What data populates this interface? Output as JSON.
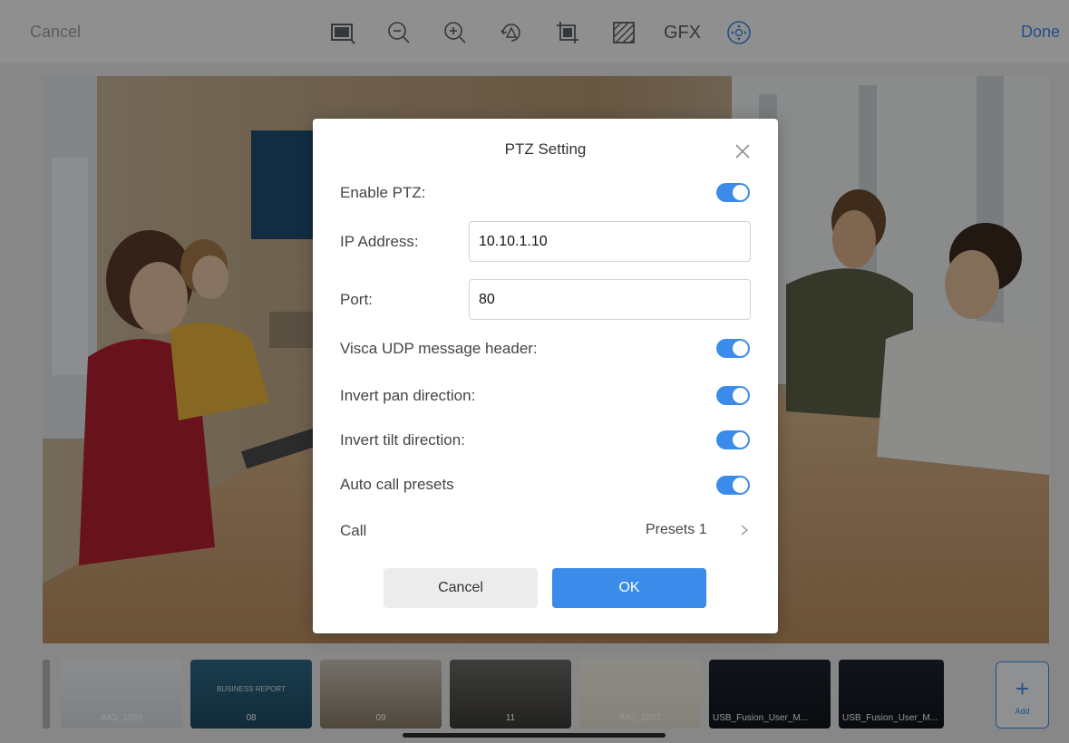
{
  "toolbar": {
    "cancel_label": "Cancel",
    "done_label": "Done",
    "gfx_label": "GFX",
    "icons": [
      "layout-icon",
      "zoom-out-icon",
      "zoom-in-icon",
      "rotate-icon",
      "crop-icon",
      "pattern-icon",
      "ptz-control-icon"
    ]
  },
  "dialog": {
    "title": "PTZ Setting",
    "enable_ptz": {
      "label": "Enable PTZ:",
      "on": true
    },
    "ip_address": {
      "label": "IP Address:",
      "value": "10.10.1.10"
    },
    "port": {
      "label": "Port:",
      "value": "80"
    },
    "visca_header": {
      "label": "Visca UDP message header:",
      "on": true
    },
    "invert_pan": {
      "label": "Invert pan direction:",
      "on": true
    },
    "invert_tilt": {
      "label": "Invert tilt direction:",
      "on": true
    },
    "auto_call": {
      "label": "Auto call presets",
      "on": true
    },
    "call": {
      "label": "Call",
      "value": "Presets 1"
    },
    "cancel_label": "Cancel",
    "ok_label": "OK"
  },
  "thumbnails": [
    {
      "caption": "IMG_1893"
    },
    {
      "caption": "08",
      "title": "BUSINESS REPORT"
    },
    {
      "caption": "09"
    },
    {
      "caption": "11"
    },
    {
      "caption": "IMG_2021"
    },
    {
      "caption": "USB_Fusion_User_M..."
    },
    {
      "caption": "USB_Fusion_User_M..."
    }
  ],
  "add_label": "Add",
  "colors": {
    "accent": "#3b8bea",
    "overlay": "rgba(0,0,0,0.42)"
  }
}
